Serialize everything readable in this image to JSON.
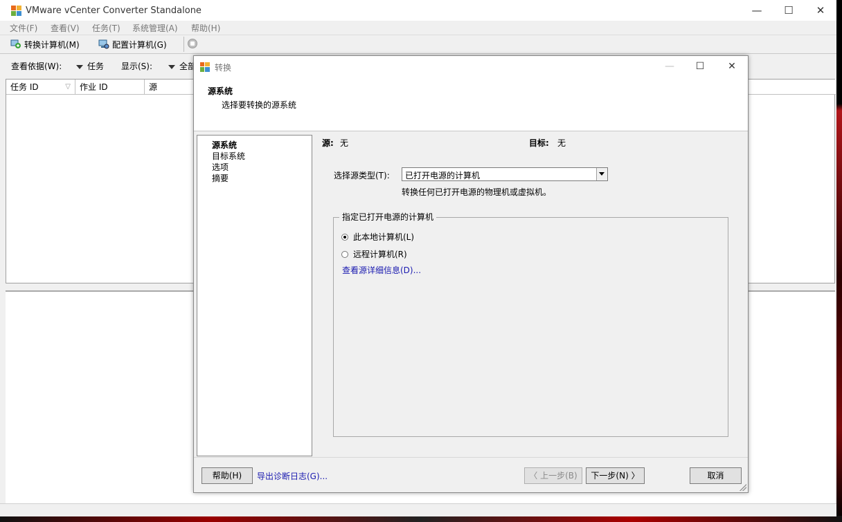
{
  "main_window": {
    "title": "VMware vCenter Converter Standalone",
    "controls": {
      "minimize": "—",
      "maximize": "☐",
      "close": "✕"
    },
    "menu": [
      "文件(F)",
      "查看(V)",
      "任务(T)",
      "系统管理(A)",
      "帮助(H)"
    ],
    "toolbar": {
      "convert_label": "转换计算机(M)",
      "configure_label": "配置计算机(G)"
    },
    "filter": {
      "view_by_label": "查看依据(W):",
      "view_by_value": "任务",
      "show_label": "显示(S):",
      "show_value": "全部"
    },
    "columns": [
      "任务 ID",
      "作业 ID",
      "源"
    ]
  },
  "dialog": {
    "title": "转换",
    "controls": {
      "minimize": "—",
      "maximize": "☐",
      "close": "✕"
    },
    "header": {
      "title": "源系统",
      "subtitle": "选择要转换的源系统"
    },
    "nav": [
      "源系统",
      "目标系统",
      "选项",
      "摘要"
    ],
    "source_label": "源:",
    "source_value": "无",
    "target_label": "目标:",
    "target_value": "无",
    "source_type_label": "选择源类型(T):",
    "source_type_value": "已打开电源的计算机",
    "source_type_hint": "转换任何已打开电源的物理机或虚拟机。",
    "group_title": "指定已打开电源的计算机",
    "radio_local": "此本地计算机(L)",
    "radio_remote": "远程计算机(R)",
    "details_link": "查看源详细信息(D)...",
    "buttons": {
      "help": "帮助(H)",
      "export_log": "导出诊断日志(G)...",
      "back": "〈 上一步(B)",
      "next": "下一步(N) 〉",
      "cancel": "取消"
    }
  },
  "colors": {
    "accent_link": "#1a1ab0",
    "window_bg": "#f0f0f0"
  }
}
